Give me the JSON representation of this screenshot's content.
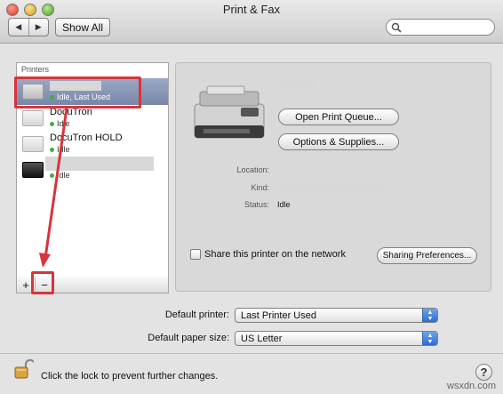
{
  "window": {
    "title": "Print & Fax",
    "nav_back": "◀",
    "nav_forward": "▶",
    "show_all": "Show All"
  },
  "sidebar": {
    "header": "Printers",
    "printers": [
      {
        "name": "",
        "status": "Idle, Last Used",
        "selected": true
      },
      {
        "name": "DocuTron",
        "status": "Idle"
      },
      {
        "name": "DocuTron HOLD",
        "status": "Idle"
      },
      {
        "name": "",
        "status": "Idle"
      }
    ],
    "add_label": "+",
    "remove_label": "−"
  },
  "detail": {
    "open_queue": "Open Print Queue...",
    "options": "Options & Supplies...",
    "location_label": "Location:",
    "location_value": "",
    "kind_label": "Kind:",
    "kind_value": "",
    "status_label": "Status:",
    "status_value": "Idle",
    "share_label": "Share this printer on the network",
    "share_checked": false,
    "sharing_prefs": "Sharing Preferences..."
  },
  "defaults": {
    "printer_label": "Default printer:",
    "printer_value": "Last Printer Used",
    "paper_label": "Default paper size:",
    "paper_value": "US Letter"
  },
  "footer": {
    "lock_text": "Click the lock to prevent further changes.",
    "help": "?",
    "watermark": "wsxdn.com"
  },
  "colors": {
    "selection": "#8796b5",
    "annotation": "#d8343c",
    "status_dot": "#3fae3f",
    "popup_arrow": "#2d6ccf"
  }
}
